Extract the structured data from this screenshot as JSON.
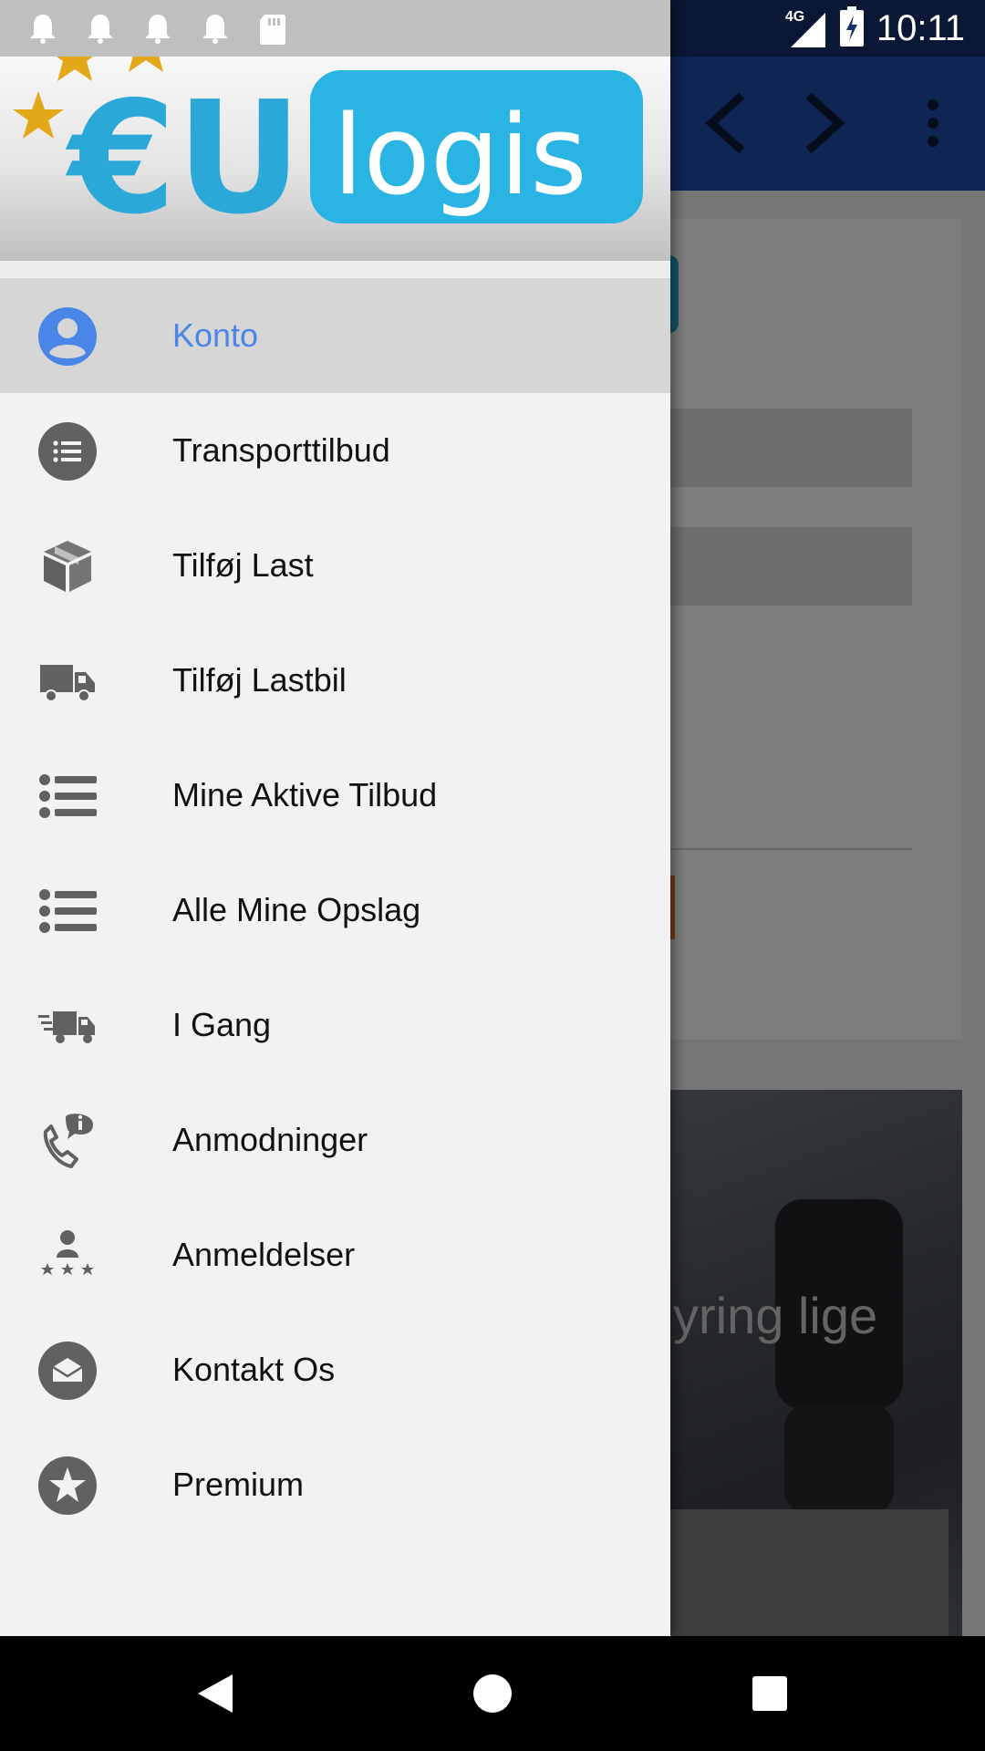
{
  "status_bar": {
    "time": "10:11",
    "network": "4G",
    "notification_icons": [
      "bell-icon",
      "bell-icon",
      "bell-icon",
      "bell-icon",
      "sd-card-icon"
    ]
  },
  "brand": {
    "logo_prefix": "€U",
    "logo_suffix": "logis",
    "primary_color": "#1f4aa8",
    "accent_color": "#29b6e6",
    "star_color": "#e3a81a"
  },
  "background": {
    "photo_caption": "yring lige"
  },
  "drawer": {
    "active_color": "#4a86e8",
    "items": [
      {
        "label": "Konto",
        "icon": "account-circle-icon",
        "active": true
      },
      {
        "label": "Transporttilbud",
        "icon": "list-circle-icon",
        "active": false
      },
      {
        "label": "Tilføj Last",
        "icon": "package-icon",
        "active": false
      },
      {
        "label": "Tilføj Lastbil",
        "icon": "truck-icon",
        "active": false
      },
      {
        "label": "Mine Aktive Tilbud",
        "icon": "bulleted-list-icon",
        "active": false
      },
      {
        "label": "Alle Mine Opslag",
        "icon": "bulleted-list-icon",
        "active": false
      },
      {
        "label": "I Gang",
        "icon": "fast-truck-icon",
        "active": false
      },
      {
        "label": "Anmodninger",
        "icon": "phone-info-icon",
        "active": false
      },
      {
        "label": "Anmeldelser",
        "icon": "reviews-icon",
        "active": false
      },
      {
        "label": "Kontakt Os",
        "icon": "mail-circle-icon",
        "active": false
      },
      {
        "label": "Premium",
        "icon": "star-circle-icon",
        "active": false
      }
    ]
  },
  "nav_bar": {
    "buttons": [
      "back-icon",
      "home-icon",
      "recents-icon"
    ]
  }
}
